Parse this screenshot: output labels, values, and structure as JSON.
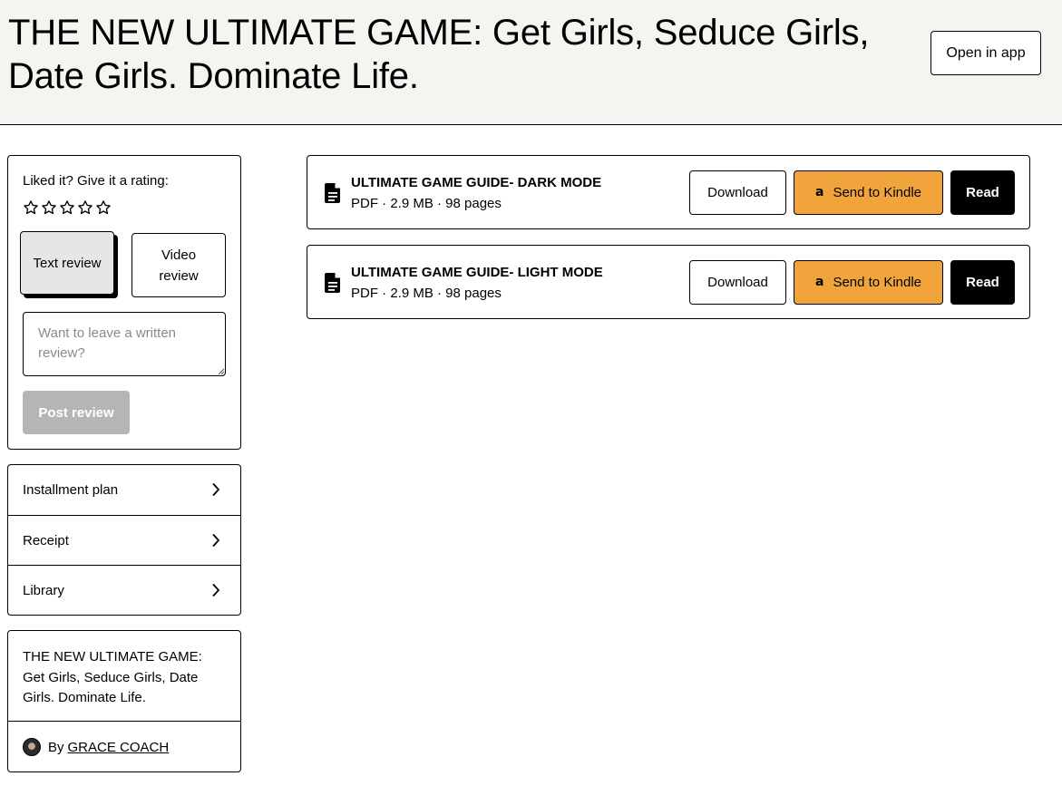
{
  "header": {
    "title": "THE NEW ULTIMATE GAME: Get Girls, Seduce Girls, Date Girls. Dominate Life.",
    "open_in_app_label": "Open in app"
  },
  "review": {
    "rating_label": "Liked it? Give it a rating:",
    "star_count": 5,
    "current_rating": 0,
    "tabs": [
      {
        "label": "Text review",
        "selected": true
      },
      {
        "label": "Video review",
        "selected": false
      }
    ],
    "input_value": "",
    "input_placeholder": "Want to leave a written review?",
    "post_label": "Post review"
  },
  "links": [
    {
      "label": "Installment plan"
    },
    {
      "label": "Receipt"
    },
    {
      "label": "Library"
    }
  ],
  "product": {
    "title": "THE NEW ULTIMATE GAME: Get Girls, Seduce Girls, Date Girls. Dominate Life.",
    "by_label": "By",
    "author": "GRACE COACH"
  },
  "files": [
    {
      "name": "ULTIMATE GAME GUIDE- DARK MODE",
      "meta": "PDF · 2.9 MB · 98 pages"
    },
    {
      "name": "ULTIMATE GAME GUIDE- LIGHT MODE",
      "meta": "PDF · 2.9 MB · 98 pages"
    }
  ],
  "file_actions": {
    "download_label": "Download",
    "kindle_label": "Send to Kindle",
    "read_label": "Read"
  },
  "colors": {
    "header_bg": "#f4f4f0",
    "kindle_accent": "#f1a43c",
    "disabled_button": "#b5b5b5",
    "selected_tab": "#e6e6e6"
  },
  "icons": {
    "star": "star-outline-icon",
    "chevron": "chevron-right-icon",
    "file": "file-document-icon",
    "kindle": "amazon-icon",
    "avatar": "avatar"
  }
}
